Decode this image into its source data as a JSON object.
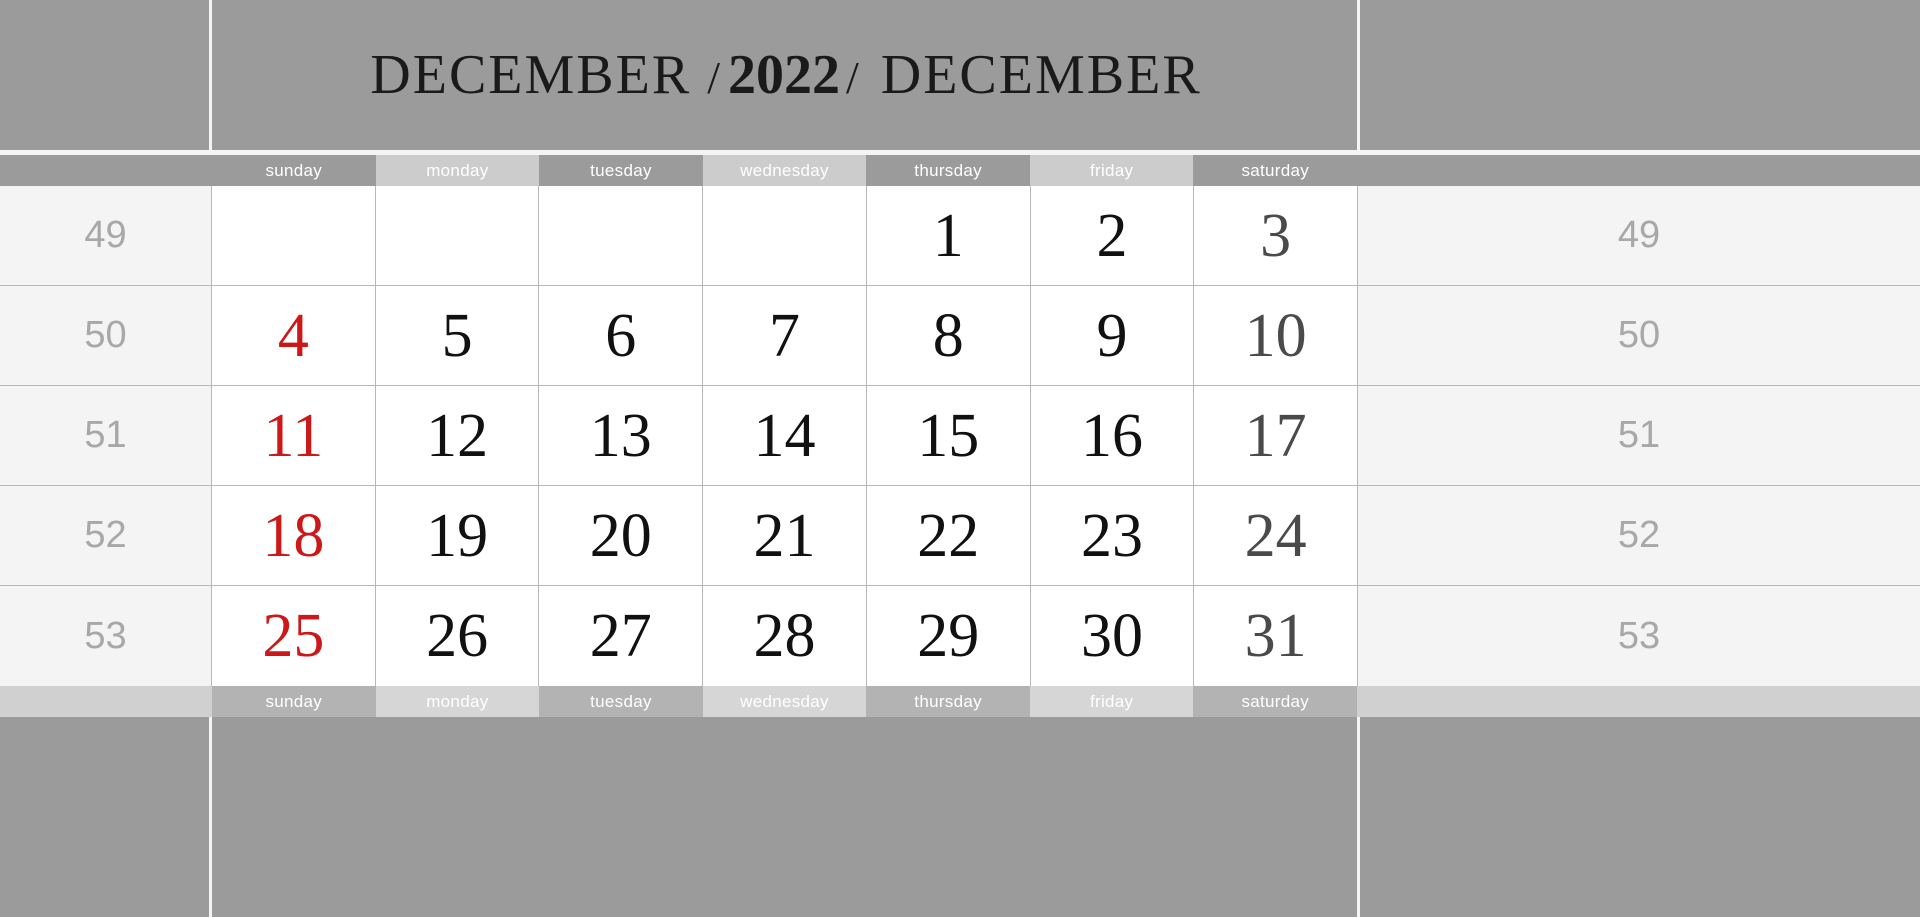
{
  "header": {
    "month_left": "DECEMBER",
    "separator": "/",
    "year": "2022",
    "month_right": "DECEMBER"
  },
  "weekdays": [
    {
      "label": "sunday",
      "shade": "dark"
    },
    {
      "label": "monday",
      "shade": "light"
    },
    {
      "label": "tuesday",
      "shade": "dark"
    },
    {
      "label": "wednesday",
      "shade": "light"
    },
    {
      "label": "thursday",
      "shade": "dark"
    },
    {
      "label": "friday",
      "shade": "light"
    },
    {
      "label": "saturday",
      "shade": "dark"
    }
  ],
  "weekdays_bottom": [
    {
      "label": "sunday",
      "shade": "dark"
    },
    {
      "label": "monday",
      "shade": "light"
    },
    {
      "label": "tuesday",
      "shade": "dark"
    },
    {
      "label": "wednesday",
      "shade": "light"
    },
    {
      "label": "thursday",
      "shade": "dark"
    },
    {
      "label": "friday",
      "shade": "light"
    },
    {
      "label": "saturday",
      "shade": "dark"
    }
  ],
  "week_numbers": [
    "49",
    "50",
    "51",
    "52",
    "53"
  ],
  "weeks": [
    {
      "week_number": "49",
      "days": [
        {
          "value": "",
          "type": "empty"
        },
        {
          "value": "",
          "type": "empty"
        },
        {
          "value": "",
          "type": "empty"
        },
        {
          "value": "",
          "type": "empty"
        },
        {
          "value": "1",
          "type": "weekday"
        },
        {
          "value": "2",
          "type": "weekday"
        },
        {
          "value": "3",
          "type": "saturday"
        }
      ]
    },
    {
      "week_number": "50",
      "days": [
        {
          "value": "4",
          "type": "sunday"
        },
        {
          "value": "5",
          "type": "weekday"
        },
        {
          "value": "6",
          "type": "weekday"
        },
        {
          "value": "7",
          "type": "weekday"
        },
        {
          "value": "8",
          "type": "weekday"
        },
        {
          "value": "9",
          "type": "weekday"
        },
        {
          "value": "10",
          "type": "saturday"
        }
      ]
    },
    {
      "week_number": "51",
      "days": [
        {
          "value": "11",
          "type": "sunday"
        },
        {
          "value": "12",
          "type": "weekday"
        },
        {
          "value": "13",
          "type": "weekday"
        },
        {
          "value": "14",
          "type": "weekday"
        },
        {
          "value": "15",
          "type": "weekday"
        },
        {
          "value": "16",
          "type": "weekday"
        },
        {
          "value": "17",
          "type": "saturday"
        }
      ]
    },
    {
      "week_number": "52",
      "days": [
        {
          "value": "18",
          "type": "sunday"
        },
        {
          "value": "19",
          "type": "weekday"
        },
        {
          "value": "20",
          "type": "weekday"
        },
        {
          "value": "21",
          "type": "weekday"
        },
        {
          "value": "22",
          "type": "weekday"
        },
        {
          "value": "23",
          "type": "weekday"
        },
        {
          "value": "24",
          "type": "saturday"
        }
      ]
    },
    {
      "week_number": "53",
      "days": [
        {
          "value": "25",
          "type": "sunday"
        },
        {
          "value": "26",
          "type": "weekday"
        },
        {
          "value": "27",
          "type": "weekday"
        },
        {
          "value": "28",
          "type": "weekday"
        },
        {
          "value": "29",
          "type": "weekday"
        },
        {
          "value": "30",
          "type": "weekday"
        },
        {
          "value": "31",
          "type": "saturday"
        }
      ]
    }
  ],
  "colors": {
    "band_gray": "#9b9b9b",
    "weekday_dark": "#9b9b9b",
    "weekday_light": "#cccccc",
    "weekday_dark_bottom": "#b3b3b3",
    "weekday_light_bottom": "#d6d6d6",
    "week_number_bg": "#f4f4f4",
    "week_number_text": "#a8a8a8",
    "sunday_red": "#cc1818",
    "saturday_gray": "#4a4a4a",
    "weekday_black": "#111111",
    "cell_border": "#b8b8b8",
    "cell_bg": "#ffffff"
  }
}
